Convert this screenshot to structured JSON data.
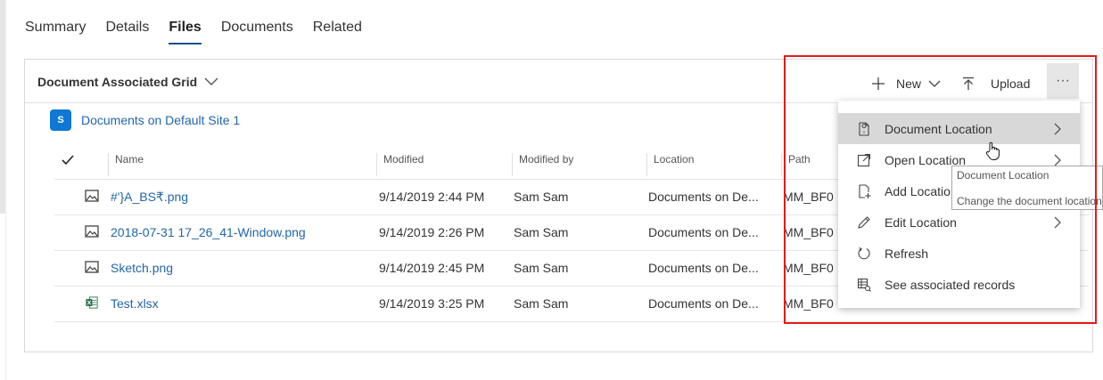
{
  "tabs": [
    {
      "label": "Summary"
    },
    {
      "label": "Details"
    },
    {
      "label": "Files"
    },
    {
      "label": "Documents"
    },
    {
      "label": "Related"
    }
  ],
  "active_tab": "Files",
  "grid": {
    "title": "Document Associated Grid",
    "commands": {
      "new_label": "New",
      "upload_label": "Upload",
      "more_label": "···"
    },
    "site_link": "Documents on Default Site 1",
    "sp_icon_letter": "S",
    "columns": [
      "Name",
      "Modified",
      "Modified by",
      "Location",
      "Path"
    ],
    "rows": [
      {
        "icon": "image-file-icon",
        "name": "#'}A_BS₹.png",
        "modified": "9/14/2019 2:44 PM",
        "modified_by": "Sam Sam",
        "location": "Documents on De...",
        "path": "MM_BF0"
      },
      {
        "icon": "image-file-icon",
        "name": "2018-07-31 17_26_41-Window.png",
        "modified": "9/14/2019 2:26 PM",
        "modified_by": "Sam Sam",
        "location": "Documents on De...",
        "path": "MM_BF0"
      },
      {
        "icon": "image-file-icon",
        "name": "Sketch.png",
        "modified": "9/14/2019 2:45 PM",
        "modified_by": "Sam Sam",
        "location": "Documents on De...",
        "path": "MM_BF0"
      },
      {
        "icon": "excel-file-icon",
        "name": "Test.xlsx",
        "modified": "9/14/2019 3:25 PM",
        "modified_by": "Sam Sam",
        "location": "Documents on De...",
        "path": "MM_BF0"
      }
    ]
  },
  "menu": {
    "items": [
      {
        "label": "Document Location",
        "icon": "document-location-icon",
        "has_submenu": true
      },
      {
        "label": "Open Location",
        "icon": "open-location-icon",
        "has_submenu": true
      },
      {
        "label": "Add Location",
        "icon": "add-location-icon",
        "has_submenu": false
      },
      {
        "label": "Edit Location",
        "icon": "edit-pencil-icon",
        "has_submenu": true
      },
      {
        "label": "Refresh",
        "icon": "refresh-icon",
        "has_submenu": false
      },
      {
        "label": "See associated records",
        "icon": "associated-records-icon",
        "has_submenu": false
      }
    ]
  },
  "tooltip": {
    "title": "Document Location",
    "description": "Change the document location"
  },
  "colors": {
    "link": "#2266a8",
    "active_tab_underline": "#1b4f8a",
    "highlight_border": "#e41b1b",
    "menu_hover": "#d8d8d8",
    "sharepoint_blue": "#0f78d4",
    "excel_green": "#1e7145"
  }
}
